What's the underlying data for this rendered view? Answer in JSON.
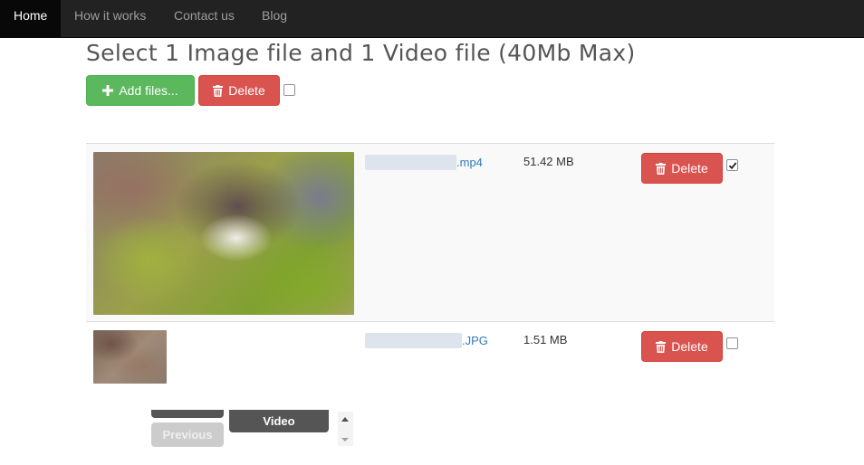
{
  "nav": {
    "items": [
      {
        "label": "Home",
        "active": true
      },
      {
        "label": "How it works",
        "active": false
      },
      {
        "label": "Contact us",
        "active": false
      },
      {
        "label": "Blog",
        "active": false
      }
    ]
  },
  "page": {
    "title": "Select 1 Image file and 1 Video file (40Mb Max)"
  },
  "toolbar": {
    "add_label": "Add files...",
    "add_icon": "plus-icon",
    "delete_label": "Delete",
    "delete_icon": "trash-icon",
    "select_all_checked": false
  },
  "files": [
    {
      "name_suffix": ".mp4",
      "size": "51.42 MB",
      "delete_label": "Delete",
      "checked": true,
      "preview": "video-thumbnail"
    },
    {
      "name_suffix": ".JPG",
      "size": "1.51 MB",
      "delete_label": "Delete",
      "checked": false,
      "preview": "image-thumbnail"
    }
  ],
  "sorter": {
    "video_label": "Video",
    "previous_label": "Previous"
  },
  "colors": {
    "navbar": "#222222",
    "success": "#5cb85c",
    "danger": "#d9534f",
    "link": "#337ab7"
  }
}
